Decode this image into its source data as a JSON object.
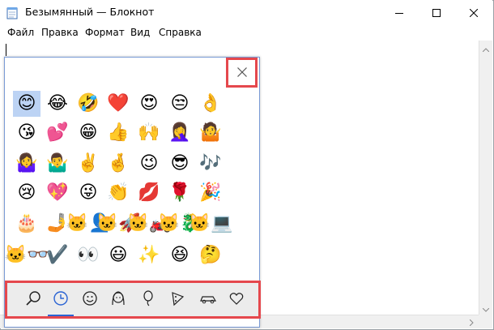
{
  "window": {
    "title": "Безымянный — Блокнот",
    "colors": {
      "accent": "#2a63d3",
      "highlight": "#e5484d",
      "selection": "#bcd3f4"
    }
  },
  "menu": [
    "Файл",
    "Правка",
    "Формат",
    "Вид",
    "Справка"
  ],
  "emoji_panel": {
    "close_icon": "close-icon",
    "grid": [
      [
        "😊",
        "😂",
        "🤣",
        "❤️",
        "😍",
        "😒",
        "👌"
      ],
      [
        "😘",
        "💕",
        "😁",
        "👍",
        "🙌",
        "🤦‍♀️",
        "🤷"
      ],
      [
        "🤷‍♀️",
        "🤷‍♂️",
        "✌️",
        "🤞",
        "😉",
        "😎",
        "🎶"
      ],
      [
        "😢",
        "💖",
        "😜",
        "👏",
        "💋",
        "🌹",
        "🎉"
      ],
      [
        "🎂",
        "🤳",
        "🐱‍👤",
        "🐱‍🚀",
        "🐱‍🏍",
        "🐱‍🐉",
        "🐱‍💻"
      ],
      [
        "🐱‍👓",
        "✔️",
        "👀",
        "😃",
        "✨",
        "😆",
        "🤔"
      ]
    ],
    "selected": [
      0,
      0
    ],
    "categories": [
      {
        "name": "search",
        "icon": "search-icon"
      },
      {
        "name": "recent",
        "icon": "clock-icon",
        "active": true
      },
      {
        "name": "smileys",
        "icon": "smiley-icon"
      },
      {
        "name": "people",
        "icon": "person-icon"
      },
      {
        "name": "celebration",
        "icon": "balloon-icon"
      },
      {
        "name": "food",
        "icon": "pizza-icon"
      },
      {
        "name": "travel",
        "icon": "car-icon"
      },
      {
        "name": "symbols",
        "icon": "heart-icon"
      }
    ]
  }
}
